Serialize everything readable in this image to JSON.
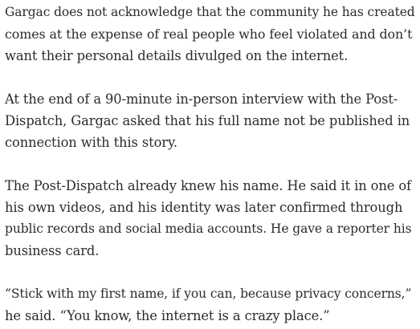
{
  "article": {
    "paragraphs": [
      {
        "lines": [
          "Gargac does not acknowledge that the community he has created",
          "comes at the expense of real people who feel violated and don’t",
          "want their personal details divulged on the internet."
        ]
      },
      {
        "lines": [
          "At the end of a 90-minute in-person interview with the Post-",
          "Dispatch, Gargac asked that his full name not be published in",
          "connection with this story."
        ]
      },
      {
        "lines": [
          "The Post-Dispatch already knew his name. He said it in one of",
          "his own videos, and his identity was later confirmed through",
          "public records and social media accounts. He gave a reporter his",
          "business card."
        ]
      },
      {
        "lines": [
          "“Stick with my first name, if you can, because privacy concerns,”",
          "he said. “You know, the internet is a crazy place.”"
        ]
      }
    ]
  }
}
